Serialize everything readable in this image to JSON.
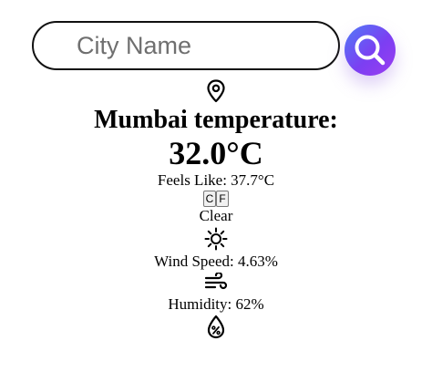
{
  "search": {
    "placeholder": "City Name",
    "value": ""
  },
  "weather": {
    "title": "Mumbai temperature:",
    "temperature": "32.0°C",
    "feels_like": "Feels Like: 37.7°C",
    "condition": "Clear",
    "wind_speed": "Wind Speed: 4.63%",
    "humidity": "Humidity: 62%"
  },
  "units": {
    "celsius_label": "C",
    "fahrenheit_label": "F"
  },
  "colors": {
    "search_gradient_start": "#4f7cf7",
    "search_gradient_end": "#9b3cf0",
    "text": "#000000"
  },
  "icons": {
    "search": "magnifier-icon",
    "location": "location-pin-icon",
    "condition": "sun-icon",
    "wind": "wind-icon",
    "humidity": "humidity-drop-icon"
  }
}
